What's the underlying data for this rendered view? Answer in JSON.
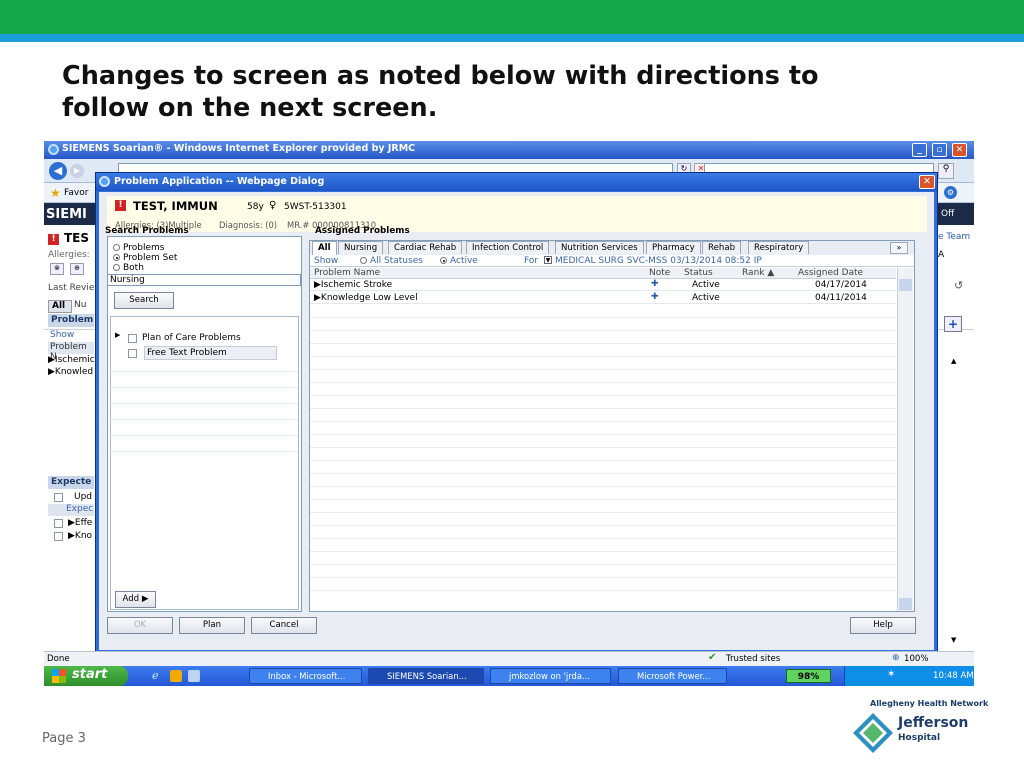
{
  "slide": {
    "title_line1": "Changes to screen as noted below with directions to",
    "title_line2": "follow on the next screen.",
    "page_label": "Page 3",
    "logo_network": "Allegheny Health Network",
    "logo_name": "Jefferson",
    "logo_sub": "Hospital",
    "colors": {
      "green_bar": "#15a84a",
      "blue_bar": "#1a9fd9"
    }
  },
  "ie": {
    "window_title": "SIEMENS Soarian® - Windows Internet Explorer provided by JRMC",
    "favorites_label": "Favor",
    "status_done": "Done",
    "status_zone": "Trusted sites",
    "status_zoom": "100%"
  },
  "background_page": {
    "brand": "SIEMI",
    "patient_short": "TES",
    "allergies_short": "Allergies:",
    "last_review": "Last Revie",
    "tab_all": "All",
    "tab_nu": "Nu",
    "problems_header": "Problem",
    "show": "Show",
    "problem_name_col": "Problem N",
    "rows": [
      "▶Ischemic",
      "▶Knowled"
    ],
    "expected_header": "Expecte",
    "update": "Upd",
    "expected_sub": "Expec",
    "exp_rows": [
      "▶Effe",
      "▶Kno"
    ],
    "right_off": "Off",
    "right_team": "e Team",
    "right_a": "A"
  },
  "dialog": {
    "title": "Problem Application -- Webpage Dialog",
    "patient": {
      "name": "TEST, IMMUN",
      "age": "58y",
      "sex_symbol": "♀",
      "location": "5WST-513301",
      "allergies": "Allergies: (3)Multiple",
      "diagnosis": "Diagnosis: (0)",
      "mrn": "MR.# 000000811310"
    },
    "search": {
      "header": "Search Problems",
      "options": [
        "Problems",
        "Problem Set",
        "Both"
      ],
      "selected_option": "Problem Set",
      "input_value": "Nursing",
      "search_button": "Search",
      "results": [
        "Plan of Care Problems",
        "Free Text Problem"
      ],
      "add_button": "Add ▶"
    },
    "assigned": {
      "header": "Assigned Problems",
      "tabs": [
        "All",
        "Nursing",
        "Cardiac Rehab",
        "Infection Control",
        "Nutrition Services",
        "Pharmacy",
        "Rehab",
        "Respiratory"
      ],
      "active_tab": "All",
      "more_tabs": "»",
      "show_label": "Show",
      "filter_all": "All Statuses",
      "filter_active": "Active",
      "for_label": "For",
      "for_value": "MEDICAL SURG SVC-MSS 03/13/2014 08:52 IP",
      "columns": [
        "Problem Name",
        "Note",
        "Status",
        "Rank ▲",
        "Assigned Date"
      ],
      "rows": [
        {
          "name": "▶Ischemic Stroke",
          "status": "Active",
          "date": "04/17/2014"
        },
        {
          "name": "▶Knowledge Low Level",
          "status": "Active",
          "date": "04/11/2014"
        }
      ]
    },
    "buttons": {
      "ok": "OK",
      "plan": "Plan",
      "cancel": "Cancel",
      "help": "Help"
    }
  },
  "taskbar": {
    "start": "start",
    "items": [
      "Inbox - Microsoft...",
      "SIEMENS Soarian...",
      "jmkozlow on 'jrda...",
      "Microsoft Power..."
    ],
    "battery": "98%",
    "clock": "10:48 AM"
  }
}
